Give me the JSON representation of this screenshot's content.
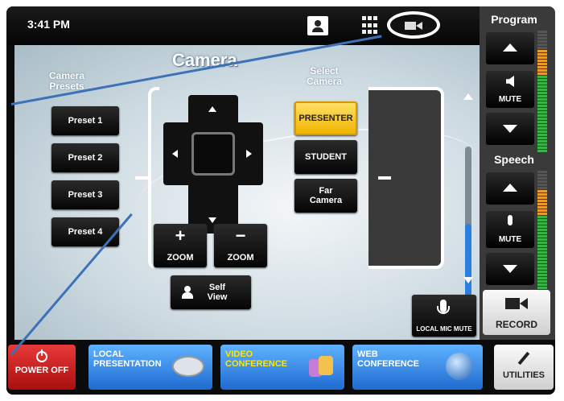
{
  "topbar": {
    "time": "3:41 PM",
    "icons": [
      "contact-icon",
      "keypad-icon",
      "camera-icon"
    ]
  },
  "main": {
    "title": "Camera",
    "presets_heading": "Camera Presets",
    "select_camera_heading": "Select Camera",
    "presets": [
      "Preset 1",
      "Preset 2",
      "Preset 3",
      "Preset 4"
    ],
    "cameras": [
      "PRESENTER",
      "STUDENT",
      "Far Camera"
    ],
    "selected_camera": "PRESENTER",
    "zoom_in": {
      "sign": "+",
      "label": "ZOOM"
    },
    "zoom_out": {
      "sign": "−",
      "label": "ZOOM"
    },
    "self_view": "Self View",
    "local_mic_mute": "LOCAL MIC MUTE",
    "scroll_level": 0.5
  },
  "right_panel": {
    "program_label": "Program",
    "program_mute": "MUTE",
    "speech_label": "Speech",
    "speech_mute": "MUTE",
    "record": "RECORD"
  },
  "bottom_bar": {
    "power": "POWER OFF",
    "local_presentation": "LOCAL PRESENTATION",
    "video_conference": "VIDEO CONFERENCE",
    "web_conference": "WEB CONFERENCE",
    "utilities": "UTILITIES"
  },
  "colors": {
    "accent_blue": "#1f6bd1",
    "selected_yellow": "#f0b400",
    "power_red": "#c01818",
    "video_conf_text": "#ffe600"
  }
}
